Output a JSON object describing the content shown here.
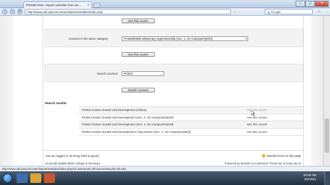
{
  "browser": {
    "tab_title": "PS/206-DNA: Import activities from an...",
    "tab_close": "×",
    "address": "http://www.udc.jww.rt/course/import/activities/index.php",
    "search_engine": "g",
    "search_placeholder": "Google",
    "controls": {
      "minimize": "–",
      "maximize": "□",
      "close": "×"
    },
    "nav": {
      "back": "‹",
      "forward": "›",
      "reload": "⟳",
      "star": "☆",
      "home": "⌂"
    }
  },
  "page": {
    "top_button": "Use this course",
    "same_category_label": "Courses in the same category",
    "same_category_selected": "PH468/MSB5 Missionary Apprenticeship (Sec. 1, On Campus/Hybrid)",
    "same_category_button": "Use this course",
    "search_label": "Search courses:",
    "search_value": "PS202",
    "search_button": "Search courses",
    "results_header": "Search results",
    "results": [
      {
        "name": "PS202 Human Growth and Development (Online)",
        "action": "Use this course",
        "faded": true
      },
      {
        "name": "PS202 Human Growth and Development (Sec. 1, On Campus/Hybrid)",
        "action": "Use this course",
        "faded": false
      },
      {
        "name": "PS202 Human Growth and Development (Sec. 2, On Campus/Hybrid)",
        "action": "Use this course",
        "faded": false
      },
      {
        "name": "PS202 Human Growth and Development, Faye Moore (Sec. 1, On Campus/Hybrid)",
        "action": "Use this course",
        "faded": false
      }
    ]
  },
  "footer": {
    "logged_in": "You are logged in as Doug Olsd (Logout)",
    "docs_link": "Moodle Docs for this page",
    "copyright": "eLearn@ Baptist Bible College & Seminary",
    "powered_by": "Powered by Moodle   AJ Customize Theme by ☰ lamp.ntp.oc"
  },
  "status_url": "http://www.udc.jww.rt/course/import/activities/index.php?id=&returnurl=2f/course/view.php?id=461",
  "clock": {
    "time": "10:06 AM",
    "date": "8/4/2011"
  },
  "colors": {
    "taskbar": "#2b3a4c",
    "titlebar": "#c8d8ec"
  }
}
